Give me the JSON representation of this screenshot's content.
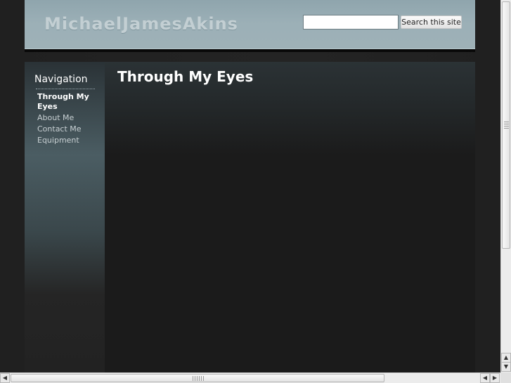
{
  "site": {
    "title": "MichaelJamesAkins"
  },
  "search": {
    "value": "",
    "placeholder": "",
    "button_label": "Search this site"
  },
  "sidebar": {
    "heading": "Navigation",
    "items": [
      {
        "label": "Through My Eyes",
        "active": true
      },
      {
        "label": "About Me",
        "active": false
      },
      {
        "label": "Contact Me",
        "active": false
      },
      {
        "label": "Equipment",
        "active": false
      }
    ]
  },
  "main": {
    "page_title": "Through My Eyes"
  },
  "scrollbars": {
    "up_arrow": "▲",
    "down_arrow": "▼",
    "left_arrow": "◀",
    "right_arrow": "▶"
  },
  "colors": {
    "header_bg": "#9cb0b7",
    "page_bg": "#1e1e1e",
    "title_text": "#c3cfd3"
  }
}
